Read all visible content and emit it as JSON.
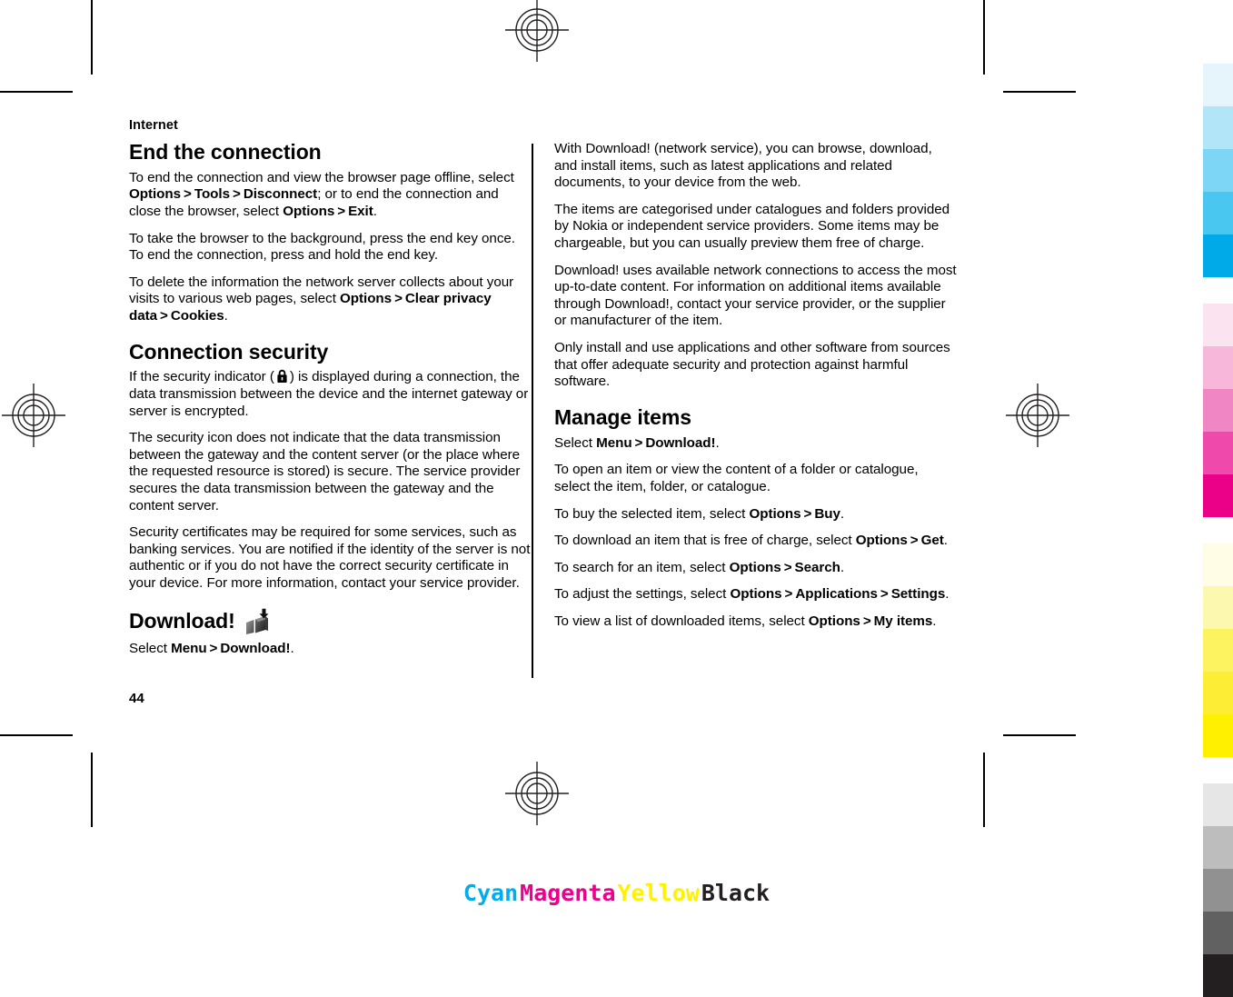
{
  "page": {
    "running_head": "Internet",
    "page_number": "44"
  },
  "left_column": {
    "heading_1": "End the connection",
    "p1": {
      "a": "To end the connection and view the browser page offline, select ",
      "b1": "Options",
      "gt1": ">",
      "b2": "Tools",
      "gt2": ">",
      "b3": "Disconnect",
      "c": "; or to end the connection and close the browser, select ",
      "b4": "Options",
      "gt3": ">",
      "b5": "Exit",
      "d": "."
    },
    "p2": "To take the browser to the background, press the end key once. To end the connection, press and hold the end key.",
    "p3": {
      "a": "To delete the information the network server collects about your visits to various web pages, select ",
      "b1": "Options",
      "gt1": ">",
      "b2": "Clear privacy data",
      "gt2": ">",
      "b3": "Cookies",
      "c": "."
    },
    "heading_2": "Connection security",
    "p4": {
      "a": "If the security indicator (",
      "icon": "lock-icon",
      "b": ") is displayed during a connection, the data transmission between the device and the internet gateway or server is encrypted."
    },
    "p5": "The security icon does not indicate that the data transmission between the gateway and the content server (or the place where the requested resource is stored) is secure. The service provider secures the data transmission between the gateway and the content server.",
    "p6": "Security certificates may be required for some services, such as banking services. You are notified if the identity of the server is not authentic or if you do not have the correct security certificate in your device. For more information, contact your service provider.",
    "heading_3": "Download!",
    "heading_3_icon": "download-box-icon",
    "p7": {
      "a": "Select ",
      "b1": "Menu",
      "gt1": ">",
      "b2": "Download!",
      "c": "."
    }
  },
  "right_column": {
    "p1": "With Download! (network service), you can browse, download, and install items, such as latest applications and related documents, to your device from the web.",
    "p2": "The items are categorised under catalogues and folders provided by Nokia or independent service providers. Some items may be chargeable, but you can usually preview them free of charge.",
    "p3": "Download! uses available network connections to access the most up-to-date content. For information on additional items available through Download!, contact your service provider, or the supplier or manufacturer of the item.",
    "p4": "Only install and use applications and other software from sources that offer adequate security and protection against harmful software.",
    "heading_1": "Manage items",
    "p5": {
      "a": "Select ",
      "b1": "Menu",
      "gt1": ">",
      "b2": "Download!",
      "c": "."
    },
    "p6": "To open an item or view the content of a folder or catalogue, select the item, folder, or catalogue.",
    "p7": {
      "a": "To buy the selected item, select ",
      "b1": "Options",
      "gt1": ">",
      "b2": "Buy",
      "c": "."
    },
    "p8": {
      "a": "To download an item that is free of charge, select ",
      "b1": "Options",
      "gt1": ">",
      "b2": "Get",
      "c": "."
    },
    "p9": {
      "a": "To search for an item, select ",
      "b1": "Options",
      "gt1": ">",
      "b2": "Search",
      "c": "."
    },
    "p10": {
      "a": "To adjust the settings, select ",
      "b1": "Options",
      "gt1": ">",
      "b2": "Applications",
      "gt2": ">",
      "b3": "Settings",
      "c": "."
    },
    "p11": {
      "a": "To view a list of downloaded items, select ",
      "b1": "Options",
      "gt1": ">",
      "b2": "My items",
      "c": "."
    }
  },
  "separation_labels": [
    {
      "text": "Cyan",
      "color": "#00aeef"
    },
    {
      "text": "Magenta",
      "color": "#ec008c"
    },
    {
      "text": "Yellow",
      "color": "#fff200"
    },
    {
      "text": "Black",
      "color": "#231f20"
    }
  ],
  "color_bar": {
    "ramps": [
      {
        "name": "cyan",
        "swatches": [
          "#e6f5fc",
          "#b3e5f8",
          "#7dd6f6",
          "#4ac7f0",
          "#00a9e8"
        ]
      },
      {
        "name": "magenta",
        "swatches": [
          "#fbe4f0",
          "#f7b7da",
          "#f186c4",
          "#ef49ab",
          "#eb0088"
        ]
      },
      {
        "name": "yellow",
        "swatches": [
          "#fffde6",
          "#fdf8b0",
          "#fdf25f",
          "#fdee35",
          "#fff000"
        ]
      },
      {
        "name": "black",
        "swatches": [
          "#e6e6e6",
          "#bdbdbd",
          "#919191",
          "#616161",
          "#231f20"
        ]
      }
    ]
  }
}
